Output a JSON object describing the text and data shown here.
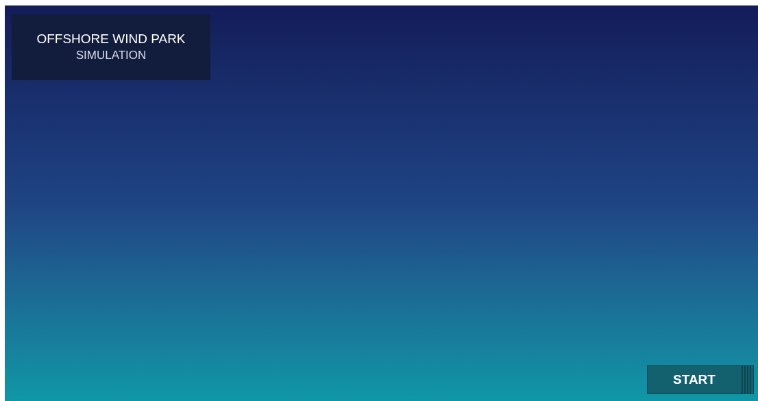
{
  "title_panel": {
    "title": "OFFSHORE WIND PARK",
    "subtitle": "SIMULATION"
  },
  "start_button": {
    "label": "START"
  }
}
